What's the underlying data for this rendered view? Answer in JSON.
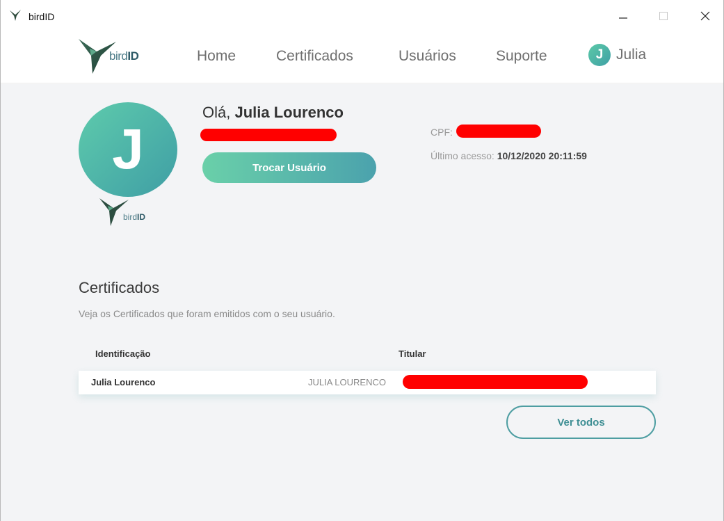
{
  "window": {
    "title": "birdID",
    "icon": "bird-logo-icon",
    "controls": {
      "minimize": "—",
      "maximize": "☐",
      "close": "✕"
    }
  },
  "nav": {
    "logo_prefix": "bird",
    "logo_suffix": "ID",
    "items": [
      "Home",
      "Certificados",
      "Usuários",
      "Suporte"
    ],
    "user_initial": "J",
    "user_name": "Julia"
  },
  "profile": {
    "avatar_initial": "J",
    "greeting_prefix": "Olá, ",
    "full_name": "Julia Lourenco",
    "switch_user_label": "Trocar Usuário",
    "cpf_label": "CPF:",
    "last_access_label": "Último acesso: ",
    "last_access_value": "10/12/2020 20:11:59",
    "logo_prefix": "bird",
    "logo_suffix": "ID"
  },
  "certificates": {
    "title": "Certificados",
    "subtitle": "Veja os Certificados que foram emitidos com o seu usuário.",
    "columns": [
      "Identificação",
      "Titular"
    ],
    "rows": [
      {
        "identificacao": "Julia Lourenco",
        "titular": "JULIA LOURENCO"
      }
    ],
    "see_all_label": "Ver todos"
  },
  "colors": {
    "accent_start": "#5ecbac",
    "accent_end": "#3f9ea5",
    "redaction": "#ff0000"
  }
}
